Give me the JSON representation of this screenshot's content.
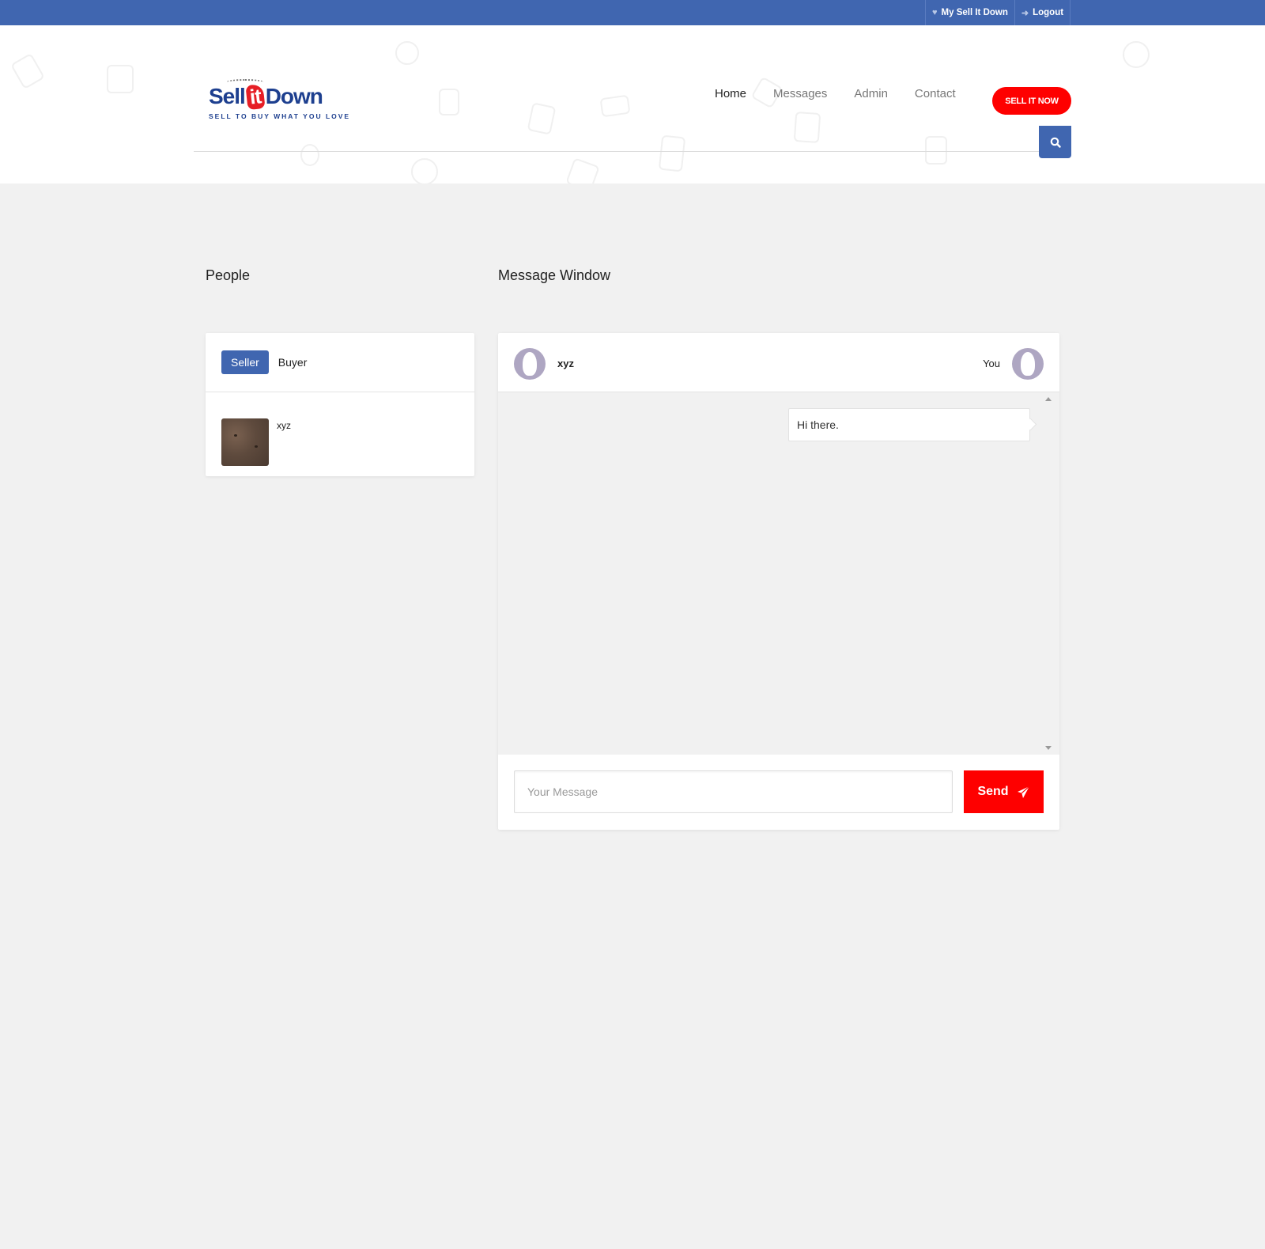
{
  "topbar": {
    "links": [
      {
        "label": "My Sell It Down",
        "icon": "heart-icon"
      },
      {
        "label": "Logout",
        "icon": "sign-in-icon"
      }
    ]
  },
  "header": {
    "logo": {
      "prefix": "Sell",
      "mid": "it",
      "suffix": "Down",
      "tagline": "SELL TO BUY WHAT YOU LOVE"
    },
    "nav": [
      {
        "label": "Home",
        "active": true
      },
      {
        "label": "Messages",
        "active": false
      },
      {
        "label": "Admin",
        "active": false
      },
      {
        "label": "Contact",
        "active": false
      }
    ],
    "cta_label": "SELL IT NOW",
    "search_icon": "search-icon"
  },
  "people": {
    "title": "People",
    "tabs": [
      {
        "label": "Seller",
        "active": true
      },
      {
        "label": "Buyer",
        "active": false
      }
    ],
    "items": [
      {
        "name": "xyz"
      }
    ]
  },
  "messages": {
    "title": "Message Window",
    "contact_name": "xyz",
    "self_label": "You",
    "thread": [
      {
        "from": "You",
        "text": "Hi there."
      }
    ],
    "input_placeholder": "Your Message",
    "input_value": "",
    "send_label": "Send",
    "send_icon": "paper-plane-icon"
  },
  "colors": {
    "brand_blue": "#4066b0",
    "accent_red": "#fe0000",
    "page_bg": "#f1f1f1"
  }
}
